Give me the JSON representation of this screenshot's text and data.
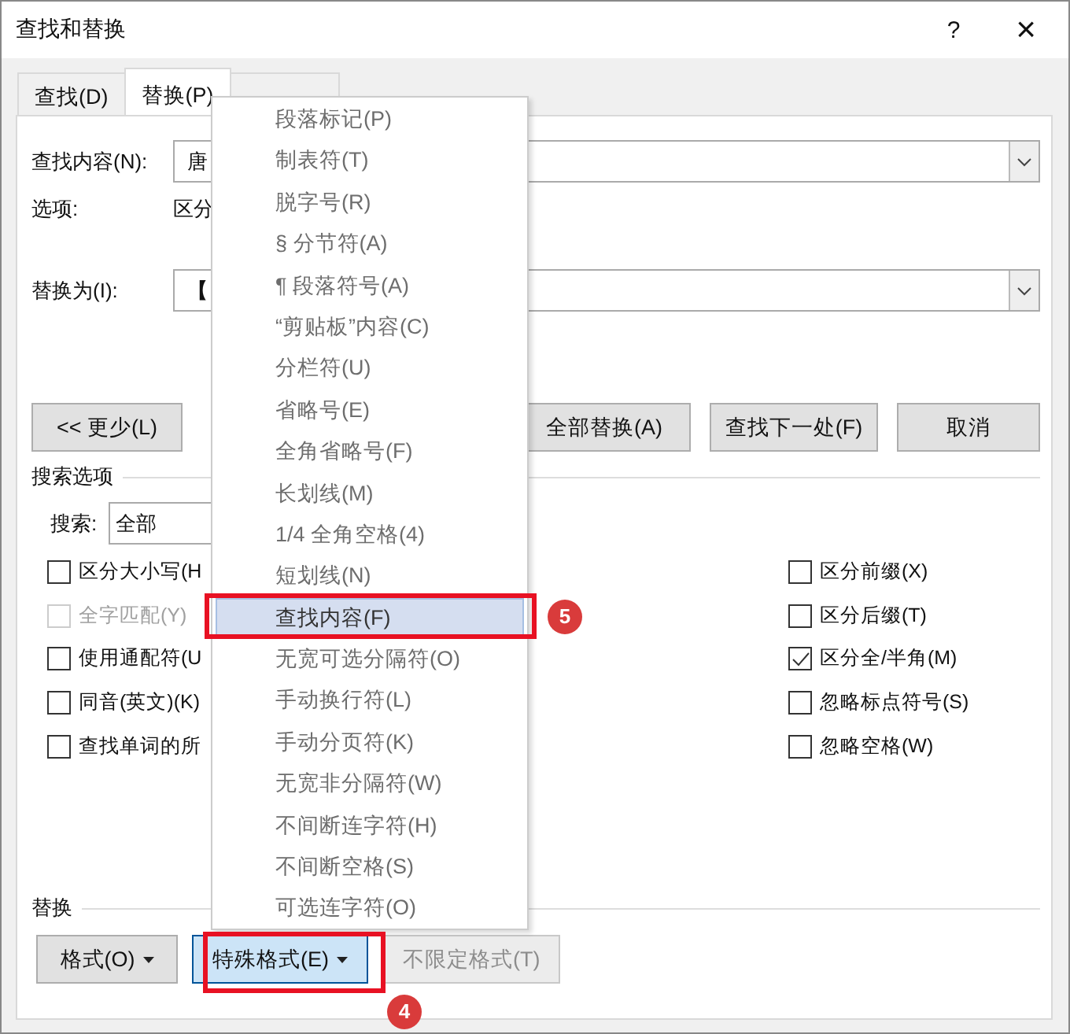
{
  "window": {
    "title": "查找和替换",
    "help": "?",
    "close": "×"
  },
  "tabs": [
    {
      "label": "查找(D)",
      "selected": false
    },
    {
      "label": "替换(P)",
      "selected": true
    },
    {
      "selected": false
    }
  ],
  "find": {
    "label": "查找内容(N):",
    "value": "唐"
  },
  "options": {
    "label": "选项:",
    "value": "区分"
  },
  "replace": {
    "label": "替换为(I):",
    "value": "【"
  },
  "buttons": [
    "<< 更少(L)",
    "全部替换(A)",
    "查找下一处(F)",
    "取消"
  ],
  "search_options": {
    "title": "搜索选项",
    "search_label": "搜索:",
    "search_value": "全部",
    "left": [
      {
        "label": "区分大小写(H",
        "checked": false,
        "disabled": false
      },
      {
        "label": "全字匹配(Y)",
        "checked": false,
        "disabled": true
      },
      {
        "label": "使用通配符(U",
        "checked": false,
        "disabled": false
      },
      {
        "label": "同音(英文)(K)",
        "checked": false,
        "disabled": false
      },
      {
        "label": "查找单词的所",
        "checked": false,
        "disabled": false
      }
    ],
    "right": [
      {
        "label": "区分前缀(X)",
        "checked": false,
        "disabled": false
      },
      {
        "label": "区分后缀(T)",
        "checked": false,
        "disabled": false
      },
      {
        "label": "区分全/半角(M)",
        "checked": true,
        "disabled": false
      },
      {
        "label": "忽略标点符号(S)",
        "checked": false,
        "disabled": false
      },
      {
        "label": "忽略空格(W)",
        "checked": false,
        "disabled": false
      }
    ]
  },
  "replace_section": {
    "title": "替换",
    "buttons": [
      {
        "label": "格式(O)",
        "pressed": false,
        "disabled": false,
        "dropdown": true
      },
      {
        "label": "特殊格式(E)",
        "pressed": true,
        "disabled": false,
        "dropdown": true
      },
      {
        "label": "不限定格式(T)",
        "pressed": false,
        "disabled": true,
        "dropdown": false
      }
    ]
  },
  "menu": [
    {
      "label": "段落标记(P)",
      "selected": false
    },
    {
      "label": "制表符(T)",
      "selected": false
    },
    {
      "label": "脱字号(R)",
      "selected": false
    },
    {
      "label": "§ 分节符(A)",
      "selected": false
    },
    {
      "label": "¶ 段落符号(A)",
      "selected": false
    },
    {
      "label": "“剪贴板”内容(C)",
      "selected": false
    },
    {
      "label": "分栏符(U)",
      "selected": false
    },
    {
      "label": "省略号(E)",
      "selected": false
    },
    {
      "label": "全角省略号(F)",
      "selected": false
    },
    {
      "label": "长划线(M)",
      "selected": false
    },
    {
      "label": "1/4 全角空格(4)",
      "selected": false
    },
    {
      "label": "短划线(N)",
      "selected": false
    },
    {
      "label": "查找内容(F)",
      "selected": true
    },
    {
      "label": "无宽可选分隔符(O)",
      "selected": false
    },
    {
      "label": "手动换行符(L)",
      "selected": false
    },
    {
      "label": "手动分页符(K)",
      "selected": false
    },
    {
      "label": "无宽非分隔符(W)",
      "selected": false
    },
    {
      "label": "不间断连字符(H)",
      "selected": false
    },
    {
      "label": "不间断空格(S)",
      "selected": false
    },
    {
      "label": "可选连字符(O)",
      "selected": false
    }
  ],
  "callouts": [
    {
      "number": "5"
    },
    {
      "number": "4"
    }
  ]
}
